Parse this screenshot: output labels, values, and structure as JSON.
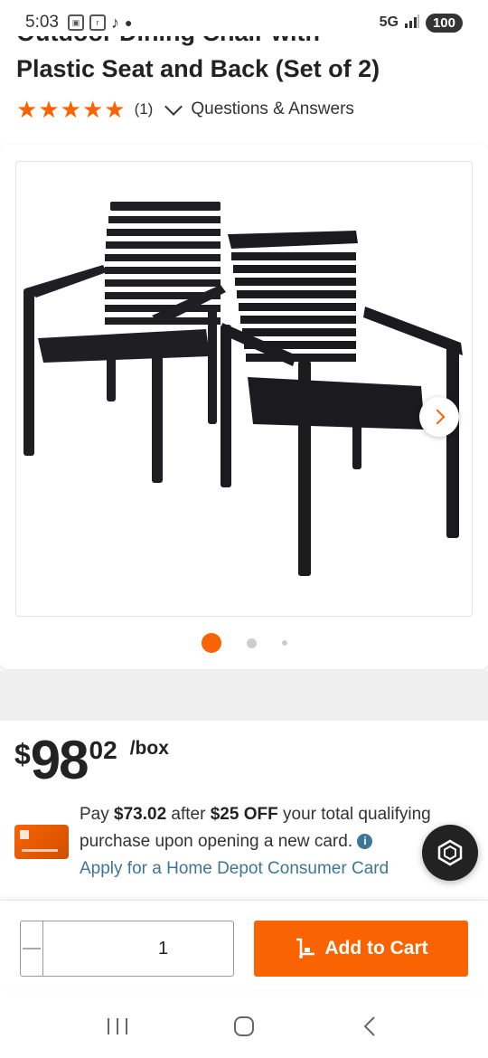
{
  "status_bar": {
    "time": "5:03",
    "network": "5G",
    "battery": "100"
  },
  "product": {
    "title_partial": "Outdoor Dining Chair with",
    "title_line2": "Plastic Seat and Back (Set of 2)",
    "rating_stars": 5,
    "review_count": "(1)",
    "qa_label": "Questions & Answers"
  },
  "gallery": {
    "image_alt": "two black outdoor dining chairs",
    "current_index": 1,
    "total_images": 3
  },
  "pricing": {
    "dollar_sign": "$",
    "dollars": "98",
    "cents": "02",
    "unit": "/box"
  },
  "offer": {
    "pay_prefix": "Pay ",
    "pay_amount": "$73.02",
    "after": " after ",
    "discount": "$25 OFF",
    "rest": " your total qualifying purchase upon opening a new card. ",
    "info_icon": "i",
    "apply_link": "Apply for a Home Depot Consumer Card"
  },
  "cart": {
    "quantity": "1",
    "add_label": "Add to Cart"
  },
  "colors": {
    "brand_orange": "#f96302",
    "link_blue": "#3e7697"
  },
  "icons": {
    "nav_recent": "recent-apps-icon",
    "nav_home": "home-icon",
    "nav_back": "back-icon"
  }
}
